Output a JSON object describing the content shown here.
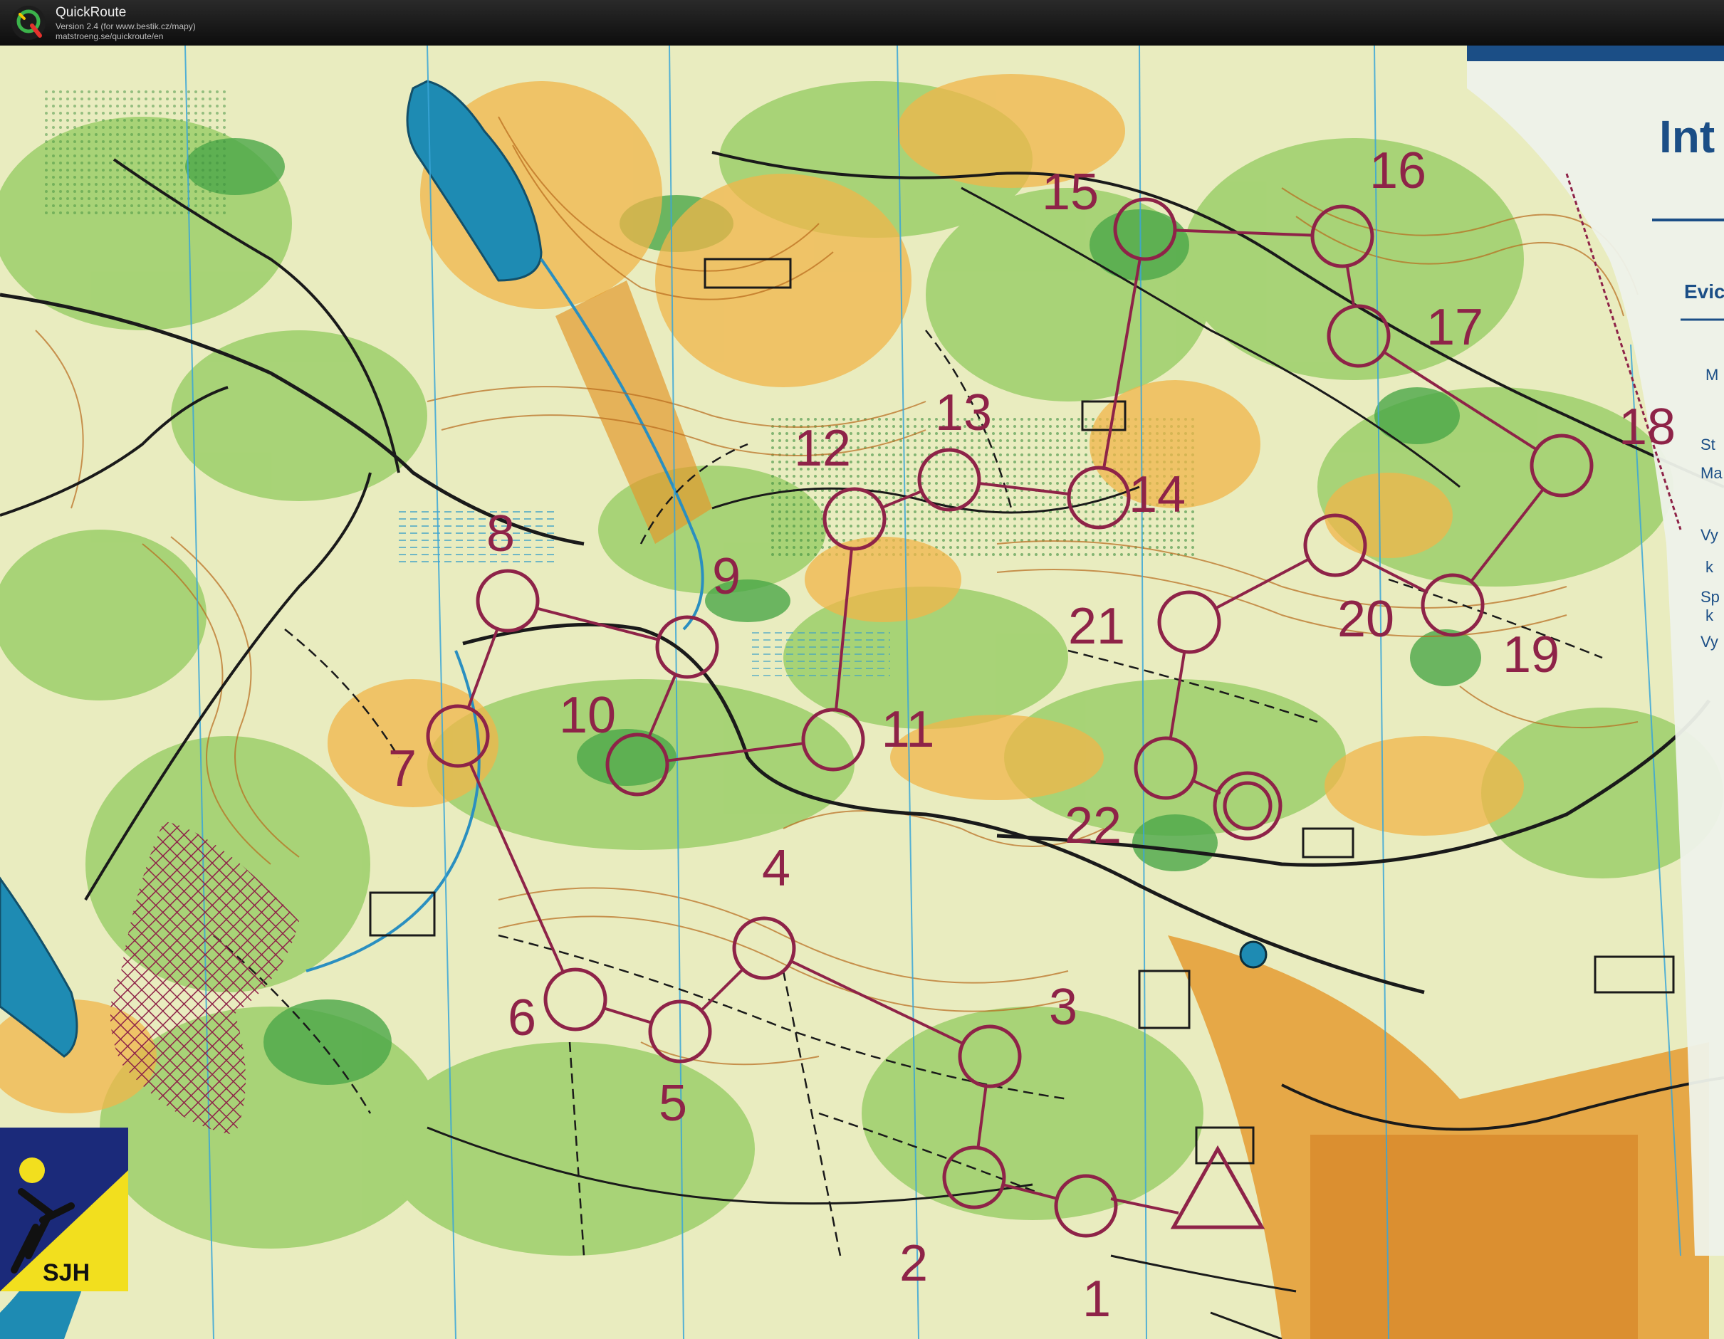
{
  "app": {
    "title": "QuickRoute",
    "version": "Version 2.4  (for www.bestik.cz/mapy)",
    "url": "matstroeng.se/quickroute/en"
  },
  "map": {
    "type": "orienteering map",
    "course_color": "#8e2348",
    "controls": [
      {
        "number": "1"
      },
      {
        "number": "2"
      },
      {
        "number": "3"
      },
      {
        "number": "4"
      },
      {
        "number": "5"
      },
      {
        "number": "6"
      },
      {
        "number": "7"
      },
      {
        "number": "8"
      },
      {
        "number": "9"
      },
      {
        "number": "10"
      },
      {
        "number": "11"
      },
      {
        "number": "12"
      },
      {
        "number": "13"
      },
      {
        "number": "14"
      },
      {
        "number": "15"
      },
      {
        "number": "16"
      },
      {
        "number": "17"
      },
      {
        "number": "18"
      },
      {
        "number": "19"
      },
      {
        "number": "20"
      },
      {
        "number": "21"
      },
      {
        "number": "22"
      }
    ],
    "club_logo_text": "SJH",
    "legend_fragments": {
      "title": "Int",
      "heading": "Evic",
      "lines": [
        "M",
        "St",
        "Ma",
        "Vy",
        "k",
        "Sp",
        "k",
        "Vy"
      ]
    }
  }
}
